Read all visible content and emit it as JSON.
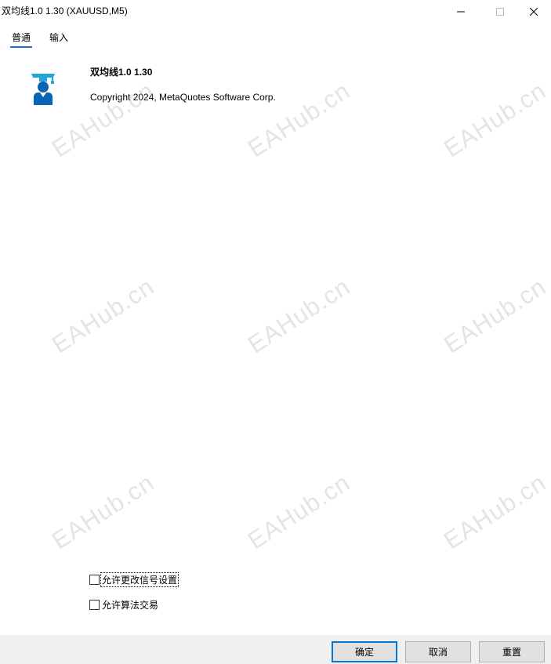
{
  "window": {
    "title": "双均线1.0 1.30 (XAUUSD,M5)"
  },
  "icons": {
    "minimize": "minimize-icon",
    "maximize": "maximize-icon",
    "close": "close-icon",
    "app": "graduate-icon"
  },
  "tabs": [
    {
      "label": "普通",
      "active": true
    },
    {
      "label": "输入",
      "active": false
    }
  ],
  "about": {
    "program_name": "双均线1.0 1.30",
    "copyright": "Copyright 2024, MetaQuotes Software Corp."
  },
  "options": [
    {
      "label": "允许更改信号设置",
      "checked": false
    },
    {
      "label": "允许算法交易",
      "checked": false
    }
  ],
  "buttons": {
    "ok": "确定",
    "cancel": "取消",
    "reset": "重置"
  },
  "watermark": "EAHub.cn",
  "colors": {
    "accent": "#1a73c9",
    "icon_blue": "#0a64b4",
    "icon_cyan": "#23a5dc",
    "default_button_border": "#0078d7",
    "bottom_bar": "#f0f0f0"
  }
}
